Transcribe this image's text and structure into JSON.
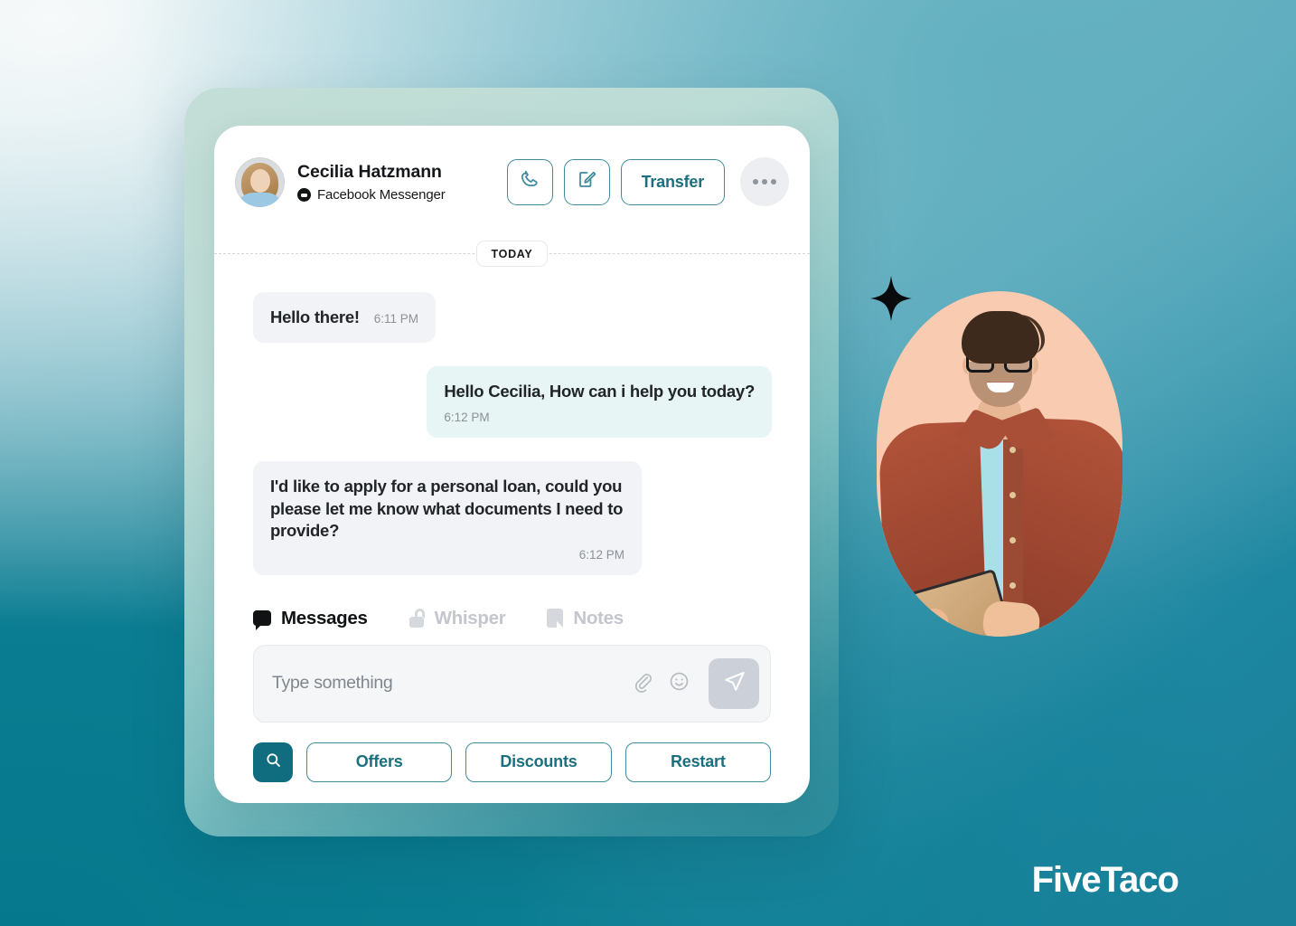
{
  "brand": {
    "name": "FiveTaco"
  },
  "header": {
    "contact_name": "Cecilia Hatzmann",
    "channel": "Facebook Messenger",
    "avatar_name": "contact-avatar",
    "actions": {
      "call_label": "call-icon",
      "compose_label": "compose-icon",
      "transfer_label": "Transfer",
      "more_label": "more-options"
    }
  },
  "divider": {
    "label": "TODAY"
  },
  "conversation": {
    "messages": [
      {
        "direction": "in",
        "text": "Hello there!",
        "time": "6:11 PM",
        "layout": "inline"
      },
      {
        "direction": "out",
        "text": "Hello Cecilia, How can i help you today?",
        "time": "6:12 PM",
        "layout": "below"
      },
      {
        "direction": "in",
        "text": "I'd like to apply for a personal loan, could you please let me know what documents I need to provide?",
        "time": "6:12 PM",
        "layout": "right"
      }
    ]
  },
  "tabs": [
    {
      "label": "Messages",
      "icon": "speech-bubble-icon",
      "state": "active"
    },
    {
      "label": "Whisper",
      "icon": "unlock-icon",
      "state": "muted"
    },
    {
      "label": "Notes",
      "icon": "note-icon",
      "state": "muted"
    }
  ],
  "composer": {
    "placeholder": "Type something",
    "value": "",
    "attach_icon": "paperclip-icon",
    "emoji_icon": "smiley-icon",
    "send_icon": "send-icon"
  },
  "quick_actions": {
    "search_icon": "search-icon",
    "chips": [
      "Offers",
      "Discounts",
      "Restart"
    ]
  },
  "colors": {
    "accent_teal": "#1b6f7f",
    "accent_border": "#3f8c9a",
    "search_bg": "#0f6d7f",
    "bubble_in": "#f2f3f6",
    "bubble_out": "#e7f5f4",
    "card_bg": "#ffffff",
    "frame_mint": "#bcdcd6",
    "photo_oval": "#f9cbb0"
  }
}
